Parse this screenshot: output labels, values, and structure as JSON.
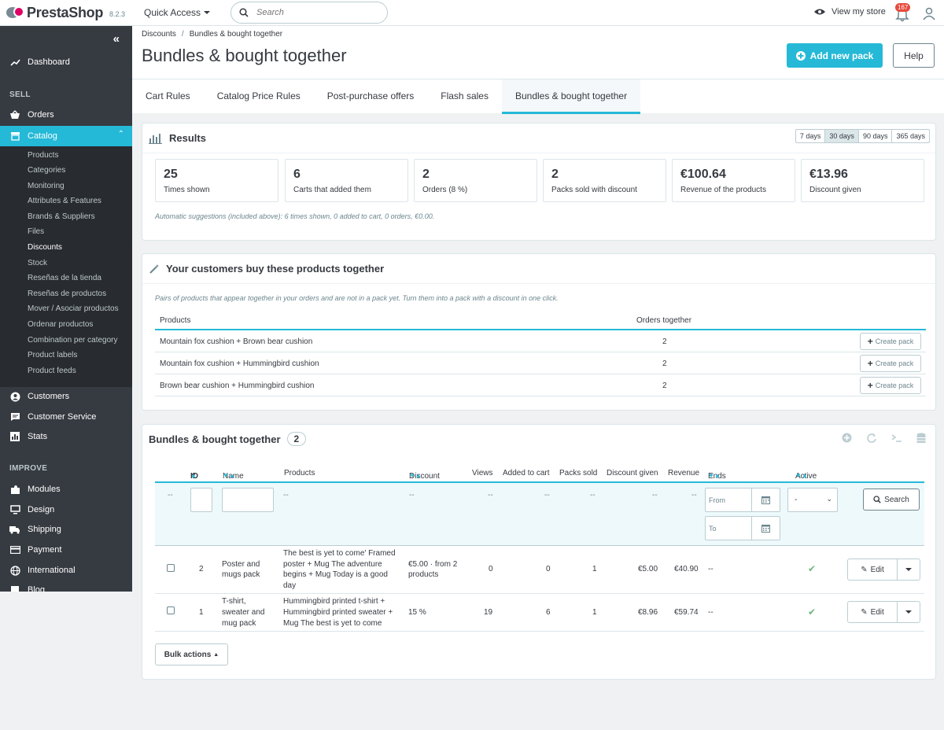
{
  "header": {
    "brand": "PrestaShop",
    "version": "8.2.3",
    "quick_access": "Quick Access",
    "search_placeholder": "Search",
    "view_store": "View my store",
    "notifications_count": "167"
  },
  "sidebar": {
    "dashboard": "Dashboard",
    "section_sell": "SELL",
    "orders": "Orders",
    "catalog": "Catalog",
    "catalog_items": [
      "Products",
      "Categories",
      "Monitoring",
      "Attributes & Features",
      "Brands & Suppliers",
      "Files",
      "Discounts",
      "Stock",
      "Reseñas de la tienda",
      "Reseñas de productos",
      "Mover / Asociar productos",
      "Ordenar productos",
      "Combination per category",
      "Product labels",
      "Product feeds"
    ],
    "customers": "Customers",
    "customer_service": "Customer Service",
    "stats": "Stats",
    "section_improve": "IMPROVE",
    "modules": "Modules",
    "design": "Design",
    "shipping": "Shipping",
    "payment": "Payment",
    "international": "International",
    "blog": "Blog"
  },
  "page": {
    "breadcrumb": [
      "Discounts",
      "Bundles & bought together"
    ],
    "title": "Bundles & bought together",
    "add_button": "Add new pack",
    "help_button": "Help",
    "tabs": [
      "Cart Rules",
      "Catalog Price Rules",
      "Post-purchase offers",
      "Flash sales",
      "Bundles & bought together"
    ]
  },
  "results": {
    "title": "Results",
    "ranges": [
      "7 days",
      "30 days",
      "90 days",
      "365 days"
    ],
    "kpis": [
      {
        "value": "25",
        "label": "Times shown"
      },
      {
        "value": "6",
        "label": "Carts that added them"
      },
      {
        "value": "2",
        "label": "Orders (8 %)"
      },
      {
        "value": "2",
        "label": "Packs sold with discount"
      },
      {
        "value": "€100.64",
        "label": "Revenue of the products"
      },
      {
        "value": "€13.96",
        "label": "Discount given"
      }
    ],
    "note": "Automatic suggestions (included above): 6 times shown, 0 added to cart, 0 orders, €0.00."
  },
  "together": {
    "title": "Your customers buy these products together",
    "note": "Pairs of products that appear together in your orders and are not in a pack yet. Turn them into a pack with a discount in one click.",
    "col_products": "Products",
    "col_orders": "Orders together",
    "create_label": "Create pack",
    "rows": [
      {
        "products": "Mountain fox cushion + Brown bear cushion",
        "orders": "2"
      },
      {
        "products": "Mountain fox cushion + Hummingbird cushion",
        "orders": "2"
      },
      {
        "products": "Brown bear cushion + Hummingbird cushion",
        "orders": "2"
      }
    ]
  },
  "bundles": {
    "title": "Bundles & bought together",
    "count": "2",
    "columns": [
      "ID",
      "Name",
      "Products",
      "Discount",
      "Views",
      "Added to cart",
      "Packs sold",
      "Discount given",
      "Revenue",
      "Ends",
      "Active"
    ],
    "filter_dash": "--",
    "from_placeholder": "From",
    "to_placeholder": "To",
    "active_select": "-",
    "search_button": "Search",
    "edit_label": "Edit",
    "bulk_label": "Bulk actions",
    "rows": [
      {
        "id": "2",
        "name": "Poster and mugs pack",
        "products": "The best is yet to come' Framed poster + Mug The adventure begins + Mug Today is a good day",
        "discount": "€5.00 · from 2 products",
        "views": "0",
        "added": "0",
        "sold": "1",
        "given": "€5.00",
        "revenue": "€40.90",
        "ends": "--"
      },
      {
        "id": "1",
        "name": "T-shirt, sweater and mug pack",
        "products": "Hummingbird printed t-shirt + Hummingbird printed sweater + Mug The best is yet to come",
        "discount": "15 %",
        "views": "19",
        "added": "6",
        "sold": "1",
        "given": "€8.96",
        "revenue": "€59.74",
        "ends": "--"
      }
    ]
  }
}
